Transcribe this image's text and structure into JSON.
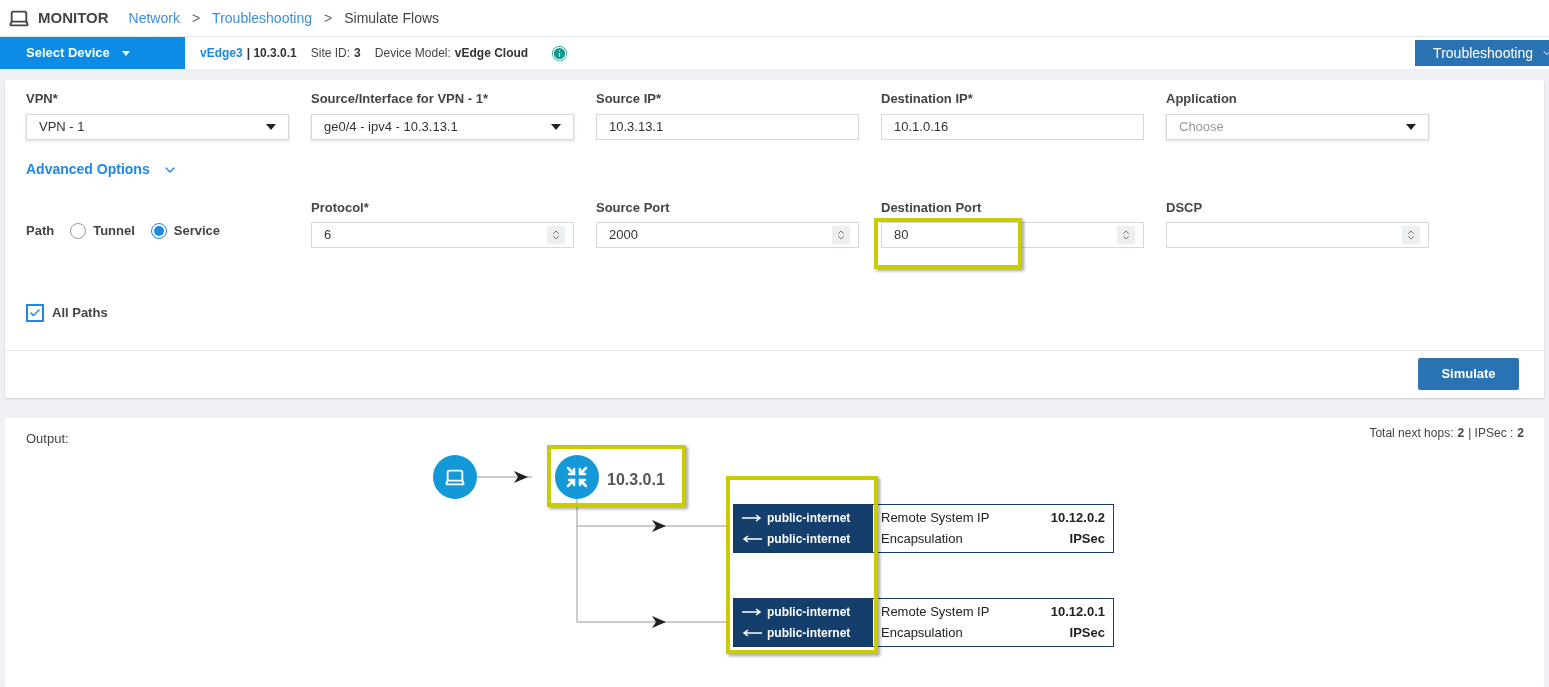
{
  "header": {
    "title": "MONITOR",
    "breadcrumbs": [
      {
        "label": "Network",
        "link": true
      },
      {
        "label": "Troubleshooting",
        "link": true
      },
      {
        "label": "Simulate Flows",
        "link": false
      }
    ],
    "separator": ">"
  },
  "device_bar": {
    "select_label": "Select Device",
    "device_name": "vEdge3",
    "device_ip": "| 10.3.0.1",
    "site_label": "Site ID:",
    "site_value": "3",
    "model_label": "Device Model:",
    "model_value": "vEdge Cloud",
    "menu_button": "Troubleshooting"
  },
  "form": {
    "fields": [
      {
        "kind": "select",
        "label": "VPN*",
        "value": "VPN - 1",
        "highlighted": false
      },
      {
        "kind": "select",
        "label": "Source/Interface for VPN - 1*",
        "value": "ge0/4 - ipv4 - 10.3.13.1",
        "highlighted": false
      },
      {
        "kind": "text",
        "label": "Source IP*",
        "value": "10.3.13.1",
        "highlighted": false
      },
      {
        "kind": "text",
        "label": "Destination IP*",
        "value": "10.1.0.16",
        "highlighted": false
      },
      {
        "kind": "select",
        "label": "Application",
        "placeholder": "Choose",
        "highlighted": false
      }
    ],
    "advanced_label": "Advanced Options",
    "advanced_expanded": true,
    "path": {
      "label": "Path",
      "options": [
        {
          "label": "Tunnel",
          "selected": false
        },
        {
          "label": "Service",
          "selected": true
        }
      ]
    },
    "advanced_fields": [
      {
        "kind": "number",
        "label": "Protocol*",
        "value": "6",
        "highlighted": false
      },
      {
        "kind": "number",
        "label": "Source Port",
        "value": "2000",
        "highlighted": false
      },
      {
        "kind": "number",
        "label": "Destination Port",
        "value": "80",
        "highlighted": true
      },
      {
        "kind": "number",
        "label": "DSCP",
        "highlighted": false
      }
    ],
    "all_paths": {
      "label": "All Paths",
      "checked": true
    },
    "submit": "Simulate"
  },
  "output": {
    "label": "Output:",
    "summary_label": "Total next hops:",
    "summary_hops": "2",
    "summary_sep": "| IPSec :",
    "summary_ipsec": "2",
    "router": {
      "label": "10.3.0.1",
      "highlighted": true
    },
    "hops_highlighted": true,
    "hops": [
      {
        "out_color": "public-internet",
        "in_color": "public-internet",
        "ip_label": "Remote System IP",
        "ip": "10.12.0.2",
        "encap_label": "Encapsulation",
        "encap": "IPSec"
      },
      {
        "out_color": "public-internet",
        "in_color": "public-internet",
        "ip_label": "Remote System IP",
        "ip": "10.12.0.1",
        "encap_label": "Encapsulation",
        "encap": "IPSec"
      }
    ]
  }
}
